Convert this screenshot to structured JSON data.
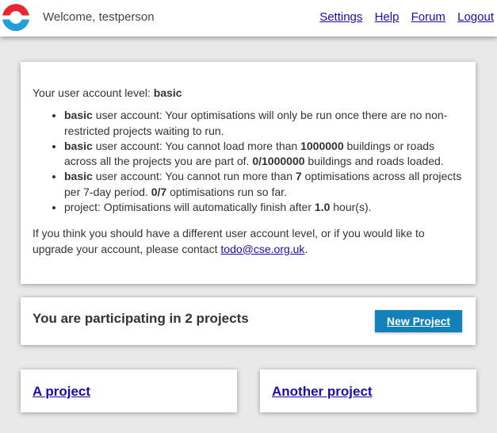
{
  "header": {
    "welcome": "Welcome, testperson",
    "nav": {
      "settings": "Settings",
      "help": "Help",
      "forum": "Forum",
      "logout": "Logout"
    }
  },
  "account": {
    "level_prefix": "Your user account level: ",
    "level": "basic",
    "items": [
      {
        "tag": "basic",
        "text": " user account: Your optimisations will only be run once there are no non-restricted projects waiting to run."
      },
      {
        "tag": "basic",
        "t1": " user account: You cannot load more than ",
        "b1": "1000000",
        "t2": " buildings or roads across all the projects you are part of. ",
        "b2": "0/1000000",
        "t3": " buildings and roads loaded."
      },
      {
        "tag": "basic",
        "t1": " user account: You cannot run more than ",
        "b1": "7",
        "t2": " optimisations across all projects per 7-day period. ",
        "b2": "0/7",
        "t3": " optimisations run so far."
      },
      {
        "t1": "project: Optimisations will automatically finish after ",
        "b1": "1.0",
        "t2": " hour(s)."
      }
    ],
    "contact_text": "If you think you should have a different user account level, or if you would like to upgrade your account, please contact ",
    "contact_email": "todo@cse.org.uk",
    "contact_end": "."
  },
  "projects": {
    "heading": "You are participating in 2 projects",
    "new_button": "New Project",
    "list": [
      "A project",
      "Another project"
    ]
  },
  "colors": {
    "logo_red": "#e8262d",
    "logo_blue": "#1ea0dc",
    "button_blue": "#1281b9",
    "link": "#1a0dab"
  }
}
